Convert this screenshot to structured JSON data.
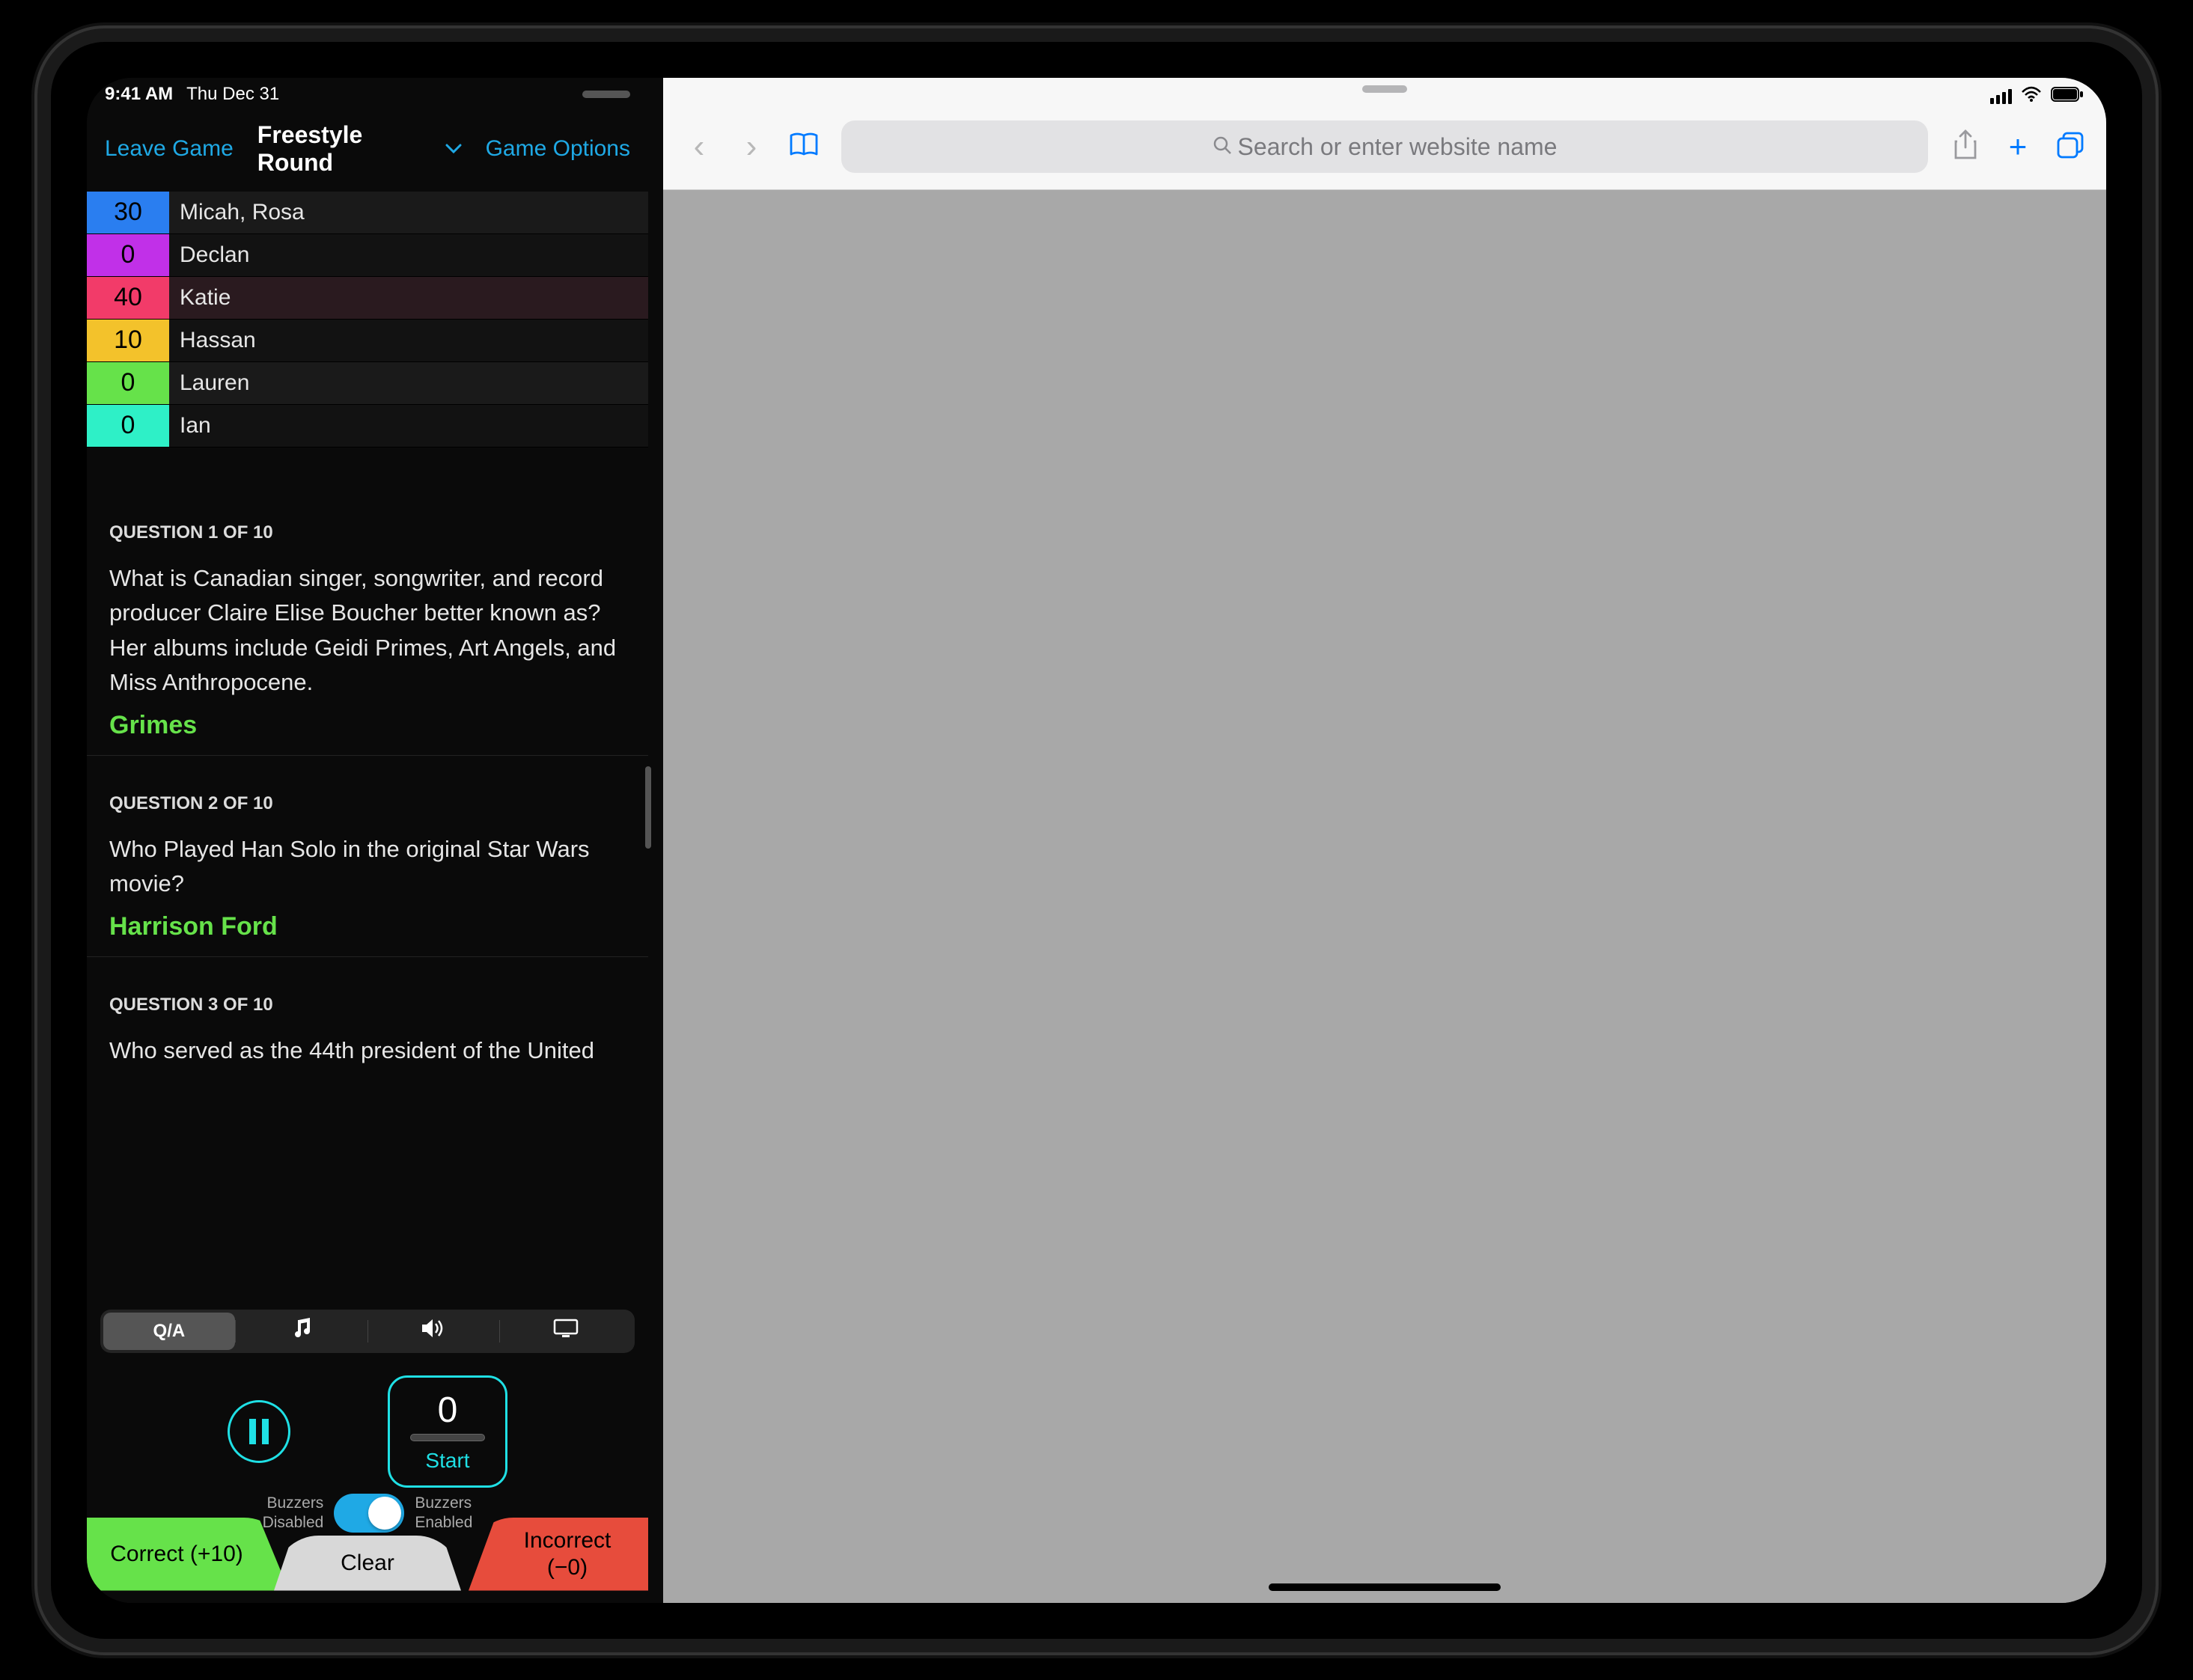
{
  "status": {
    "time": "9:41 AM",
    "date": "Thu Dec 31"
  },
  "nav": {
    "leave": "Leave Game",
    "title": "Freestyle Round",
    "options": "Game Options"
  },
  "players": [
    {
      "score": "30",
      "name": "Micah, Rosa",
      "color": "#2a7ef0",
      "bg": "#1a1a1a"
    },
    {
      "score": "0",
      "name": "Declan",
      "color": "#c130e8",
      "bg": "#121212"
    },
    {
      "score": "40",
      "name": "Katie",
      "color": "#f23b69",
      "bg": "#2a1a1f"
    },
    {
      "score": "10",
      "name": "Hassan",
      "color": "#f3c22b",
      "bg": "#121212"
    },
    {
      "score": "0",
      "name": "Lauren",
      "color": "#66e24a",
      "bg": "#1a1a1a"
    },
    {
      "score": "0",
      "name": "Ian",
      "color": "#2ef0c7",
      "bg": "#121212"
    }
  ],
  "q1": {
    "header": "QUESTION 1 OF 10",
    "text": "What is Canadian singer, songwriter, and record producer Claire Elise Boucher better known as? Her albums include Geidi Primes, Art Angels, and Miss Anthropocene.",
    "answer": "Grimes"
  },
  "q2": {
    "header": "QUESTION 2 OF 10",
    "text": "Who Played Han Solo in the original Star Wars movie?",
    "answer": "Harrison Ford"
  },
  "q3": {
    "header": "QUESTION 3 OF 10",
    "text": "Who served as the 44th president of the United"
  },
  "seg": {
    "qa": "Q/A"
  },
  "timer": {
    "value": "0",
    "start": "Start"
  },
  "buzzer": {
    "disabled": "Buzzers\nDisabled",
    "enabled": "Buzzers\nEnabled"
  },
  "btns": {
    "correct": "Correct (+10)",
    "clear": "Clear",
    "incorrectTop": "Incorrect",
    "incorrectBot": "(−0)"
  },
  "safari": {
    "placeholder": "Search or enter website name"
  }
}
